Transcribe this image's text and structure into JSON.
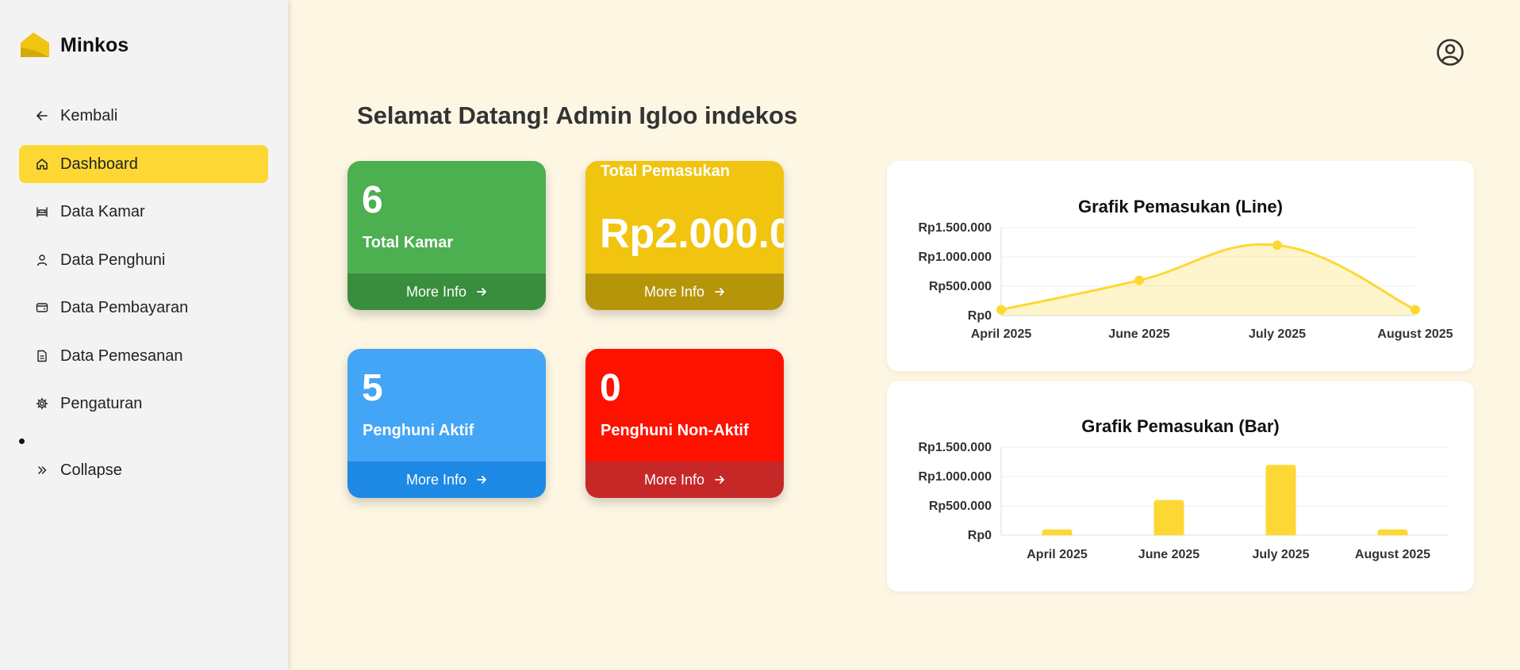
{
  "sidebar": {
    "brand": "Minkos",
    "items": [
      {
        "label": "Kembali",
        "icon": "arrow-left-icon"
      },
      {
        "label": "Dashboard",
        "icon": "home-icon",
        "active": true
      },
      {
        "label": "Data Kamar",
        "icon": "bed-icon"
      },
      {
        "label": "Data Penghuni",
        "icon": "user-icon"
      },
      {
        "label": "Data Pembayaran",
        "icon": "wallet-icon"
      },
      {
        "label": "Data Pemesanan",
        "icon": "document-icon"
      },
      {
        "label": "Pengaturan",
        "icon": "gear-icon"
      }
    ],
    "collapse_label": "Collapse"
  },
  "header": {
    "title": "Selamat Datang! Admin Igloo indekos",
    "profile_icon": "user-circle-icon"
  },
  "cards": [
    {
      "value": "6",
      "label": "Total Kamar",
      "more": "More Info",
      "color": "#4caf50"
    },
    {
      "value": "Rp2.000.0",
      "label": "Total Pemasukan",
      "more": "More Info",
      "color": "#f1c40f"
    },
    {
      "value": "5",
      "label": "Penghuni Aktif",
      "more": "More Info",
      "color": "#42a5f5"
    },
    {
      "value": "0",
      "label": "Penghuni Non-Aktif",
      "more": "More Info",
      "color": "#ff1100"
    }
  ],
  "colors": {
    "accent": "#fdd835",
    "background": "#fdf6e3"
  },
  "chart_data": [
    {
      "type": "area",
      "title": "Grafik Pemasukan (Line)",
      "categories": [
        "April 2025",
        "June 2025",
        "July 2025",
        "August 2025"
      ],
      "values": [
        100000,
        600000,
        1200000,
        100000
      ],
      "y_ticks": [
        "Rp0",
        "Rp500.000",
        "Rp1.000.000",
        "Rp1.500.000"
      ],
      "ylim": [
        0,
        1500000
      ],
      "color": "#fdd835",
      "grid": true
    },
    {
      "type": "bar",
      "title": "Grafik Pemasukan (Bar)",
      "categories": [
        "April 2025",
        "June 2025",
        "July 2025",
        "August 2025"
      ],
      "values": [
        100000,
        600000,
        1200000,
        100000
      ],
      "y_ticks": [
        "Rp0",
        "Rp500.000",
        "Rp1.000.000",
        "Rp1.500.000"
      ],
      "ylim": [
        0,
        1500000
      ],
      "color": "#fdd835",
      "grid": true
    }
  ]
}
